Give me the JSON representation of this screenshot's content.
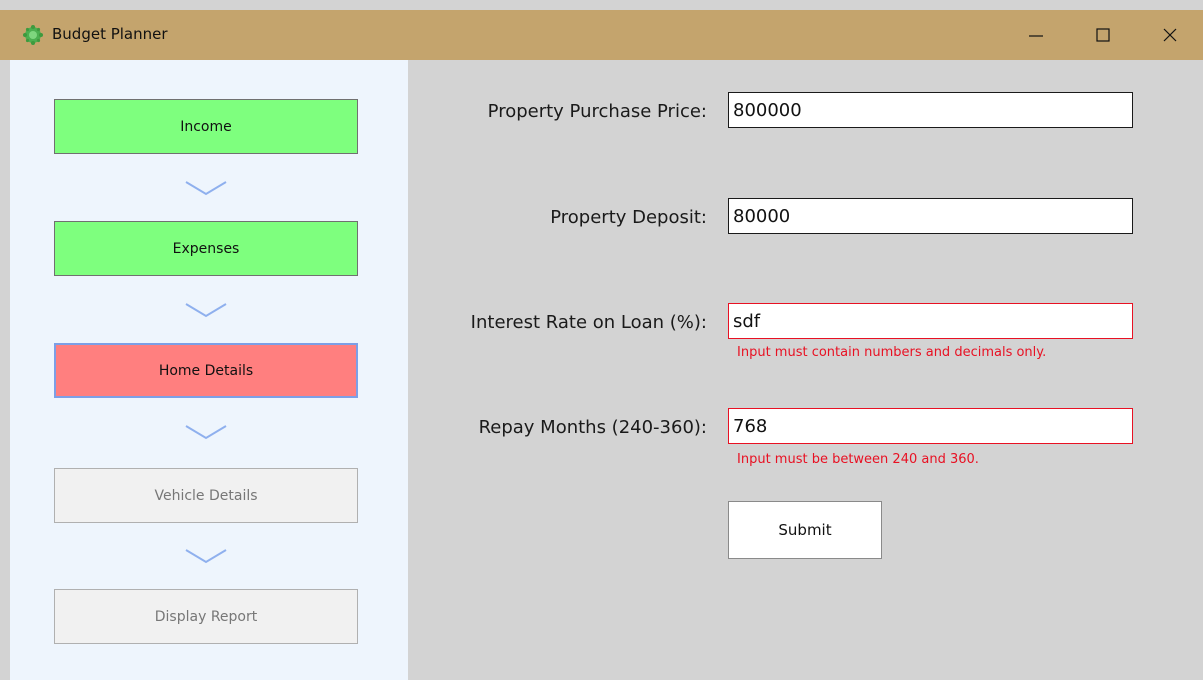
{
  "window": {
    "title": "Budget Planner",
    "title_icon": "app-logo-icon",
    "controls": [
      "minimize-icon",
      "maximize-icon",
      "close-icon"
    ]
  },
  "sidebar": {
    "steps": [
      {
        "label": "Income",
        "state": "done"
      },
      {
        "label": "Expenses",
        "state": "done"
      },
      {
        "label": "Home Details",
        "state": "current"
      },
      {
        "label": "Vehicle Details",
        "state": "pending"
      },
      {
        "label": "Display Report",
        "state": "pending"
      }
    ],
    "connector_icon": "chevron-down-icon"
  },
  "form": {
    "purchase_price": {
      "label": "Property Purchase Price:",
      "value": "800000"
    },
    "deposit": {
      "label": "Property Deposit:",
      "value": "80000"
    },
    "interest_rate": {
      "label": "Interest Rate on Loan (%):",
      "value": "sdf",
      "error": "Input must contain numbers and decimals only."
    },
    "repay_months": {
      "label": "Repay Months (240-360):",
      "value": "768",
      "error": "Input must be between 240 and 360."
    },
    "submit_label": "Submit"
  },
  "colors": {
    "titlebar": "#c4a46d",
    "sidebar_bg": "#eef5fd",
    "content_bg": "#d3d3d3",
    "step_done": "#7eff7e",
    "step_current": "#ff7f7f",
    "step_pending": "#f1f1f1",
    "error": "#e81123",
    "chevron": "#7d9fe6"
  }
}
